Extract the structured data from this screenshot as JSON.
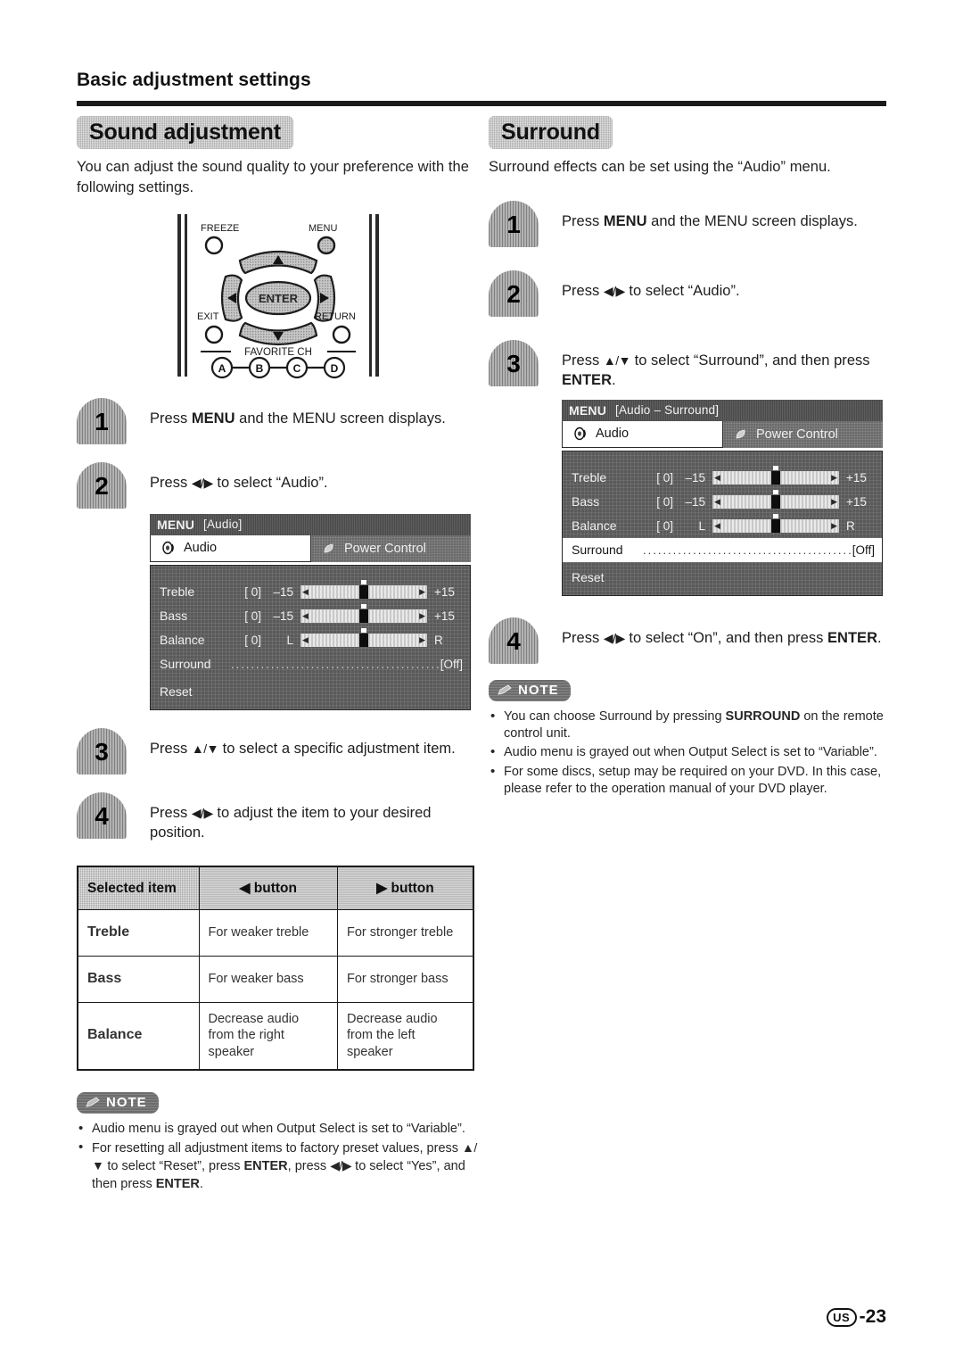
{
  "page": {
    "title": "Basic adjustment settings",
    "footer_region": "US",
    "footer_number": "-23"
  },
  "left_column": {
    "section_title": "Sound adjustment",
    "lede": "You can adjust the sound quality to your preference with the following settings.",
    "remote": {
      "labels": {
        "freeze": "FREEZE",
        "menu": "MENU",
        "exit": "EXIT",
        "return": "RETURN",
        "favorite_ch": "FAVORITE CH",
        "enter": "ENTER"
      },
      "favorite_buttons": [
        "A",
        "B",
        "C",
        "D"
      ]
    },
    "steps": [
      {
        "num": "1",
        "html": "Press <b>MENU</b> and the MENU screen displays."
      },
      {
        "num": "2",
        "html": "Press <span class=\"arr\">◀/▶</span> to select “Audio”."
      },
      {
        "num": "3",
        "html": "Press <span class=\"arr\">▲/▼</span> to select a specific adjustment item."
      },
      {
        "num": "4",
        "html": "Press <span class=\"arr\">◀/▶</span> to adjust the item to your desired position."
      }
    ],
    "osd": {
      "title": "MENU",
      "subtitle": "[Audio]",
      "tabs": [
        {
          "label": "Audio",
          "icon": "speaker-icon",
          "active": true
        },
        {
          "label": "Power Control",
          "icon": "power-leaf-icon",
          "active": false
        }
      ],
      "rows": [
        {
          "label": "Treble",
          "value": "[  0]",
          "low": "–15",
          "high": "+15"
        },
        {
          "label": "Bass",
          "value": "[  0]",
          "low": "–15",
          "high": "+15"
        },
        {
          "label": "Balance",
          "value": "[  0]",
          "low": "L",
          "high": "R"
        }
      ],
      "surround_label": "Surround",
      "surround_value": "[Off]",
      "surround_highlighted": false,
      "reset_label": "Reset"
    },
    "table": {
      "headers": [
        "Selected item",
        "◀ button",
        "▶ button"
      ],
      "rows": [
        {
          "item": "Treble",
          "left": "For weaker treble",
          "right": "For stronger treble"
        },
        {
          "item": "Bass",
          "left": "For weaker bass",
          "right": "For stronger bass"
        },
        {
          "item": "Balance",
          "left": "Decrease audio from the right speaker",
          "right": "Decrease audio from the left speaker"
        }
      ]
    },
    "note": {
      "badge": "NOTE",
      "items": [
        "Audio menu is grayed out when Output Select is set to “Variable”.",
        "For resetting all adjustment items to factory preset values, press <span class=\"arr\">▲/▼</span> to select “Reset”, press <b>ENTER</b>, press <span class=\"arr\">◀/▶</span> to select “Yes”, and then press <b>ENTER</b>."
      ]
    }
  },
  "right_column": {
    "section_title": "Surround",
    "lede": "Surround effects can be set using the “Audio” menu.",
    "steps": [
      {
        "num": "1",
        "html": "Press <b>MENU</b> and the MENU screen displays."
      },
      {
        "num": "2",
        "html": "Press <span class=\"arr\">◀/▶</span> to select “Audio”."
      },
      {
        "num": "3",
        "html": "Press <span class=\"arr\">▲/▼</span> to select “Surround”, and then press <b>ENTER</b>."
      },
      {
        "num": "4",
        "html": "Press <span class=\"arr\">◀/▶</span> to select “On”, and then press <b>ENTER</b>."
      }
    ],
    "osd": {
      "title": "MENU",
      "subtitle": "[Audio – Surround]",
      "tabs": [
        {
          "label": "Audio",
          "icon": "speaker-icon",
          "active": true
        },
        {
          "label": "Power Control",
          "icon": "power-leaf-icon",
          "active": false
        }
      ],
      "rows": [
        {
          "label": "Treble",
          "value": "[  0]",
          "low": "–15",
          "high": "+15"
        },
        {
          "label": "Bass",
          "value": "[  0]",
          "low": "–15",
          "high": "+15"
        },
        {
          "label": "Balance",
          "value": "[  0]",
          "low": "L",
          "high": "R"
        }
      ],
      "surround_label": "Surround",
      "surround_value": "[Off]",
      "surround_highlighted": true,
      "reset_label": "Reset"
    },
    "note": {
      "badge": "NOTE",
      "items": [
        "You can choose Surround by pressing <b>SURROUND</b> on the remote control unit.",
        "Audio menu is grayed out when Output Select is set to “Variable”.",
        "For some discs, setup may be required on your DVD. In this case, please refer to the operation manual of your DVD player."
      ]
    }
  }
}
